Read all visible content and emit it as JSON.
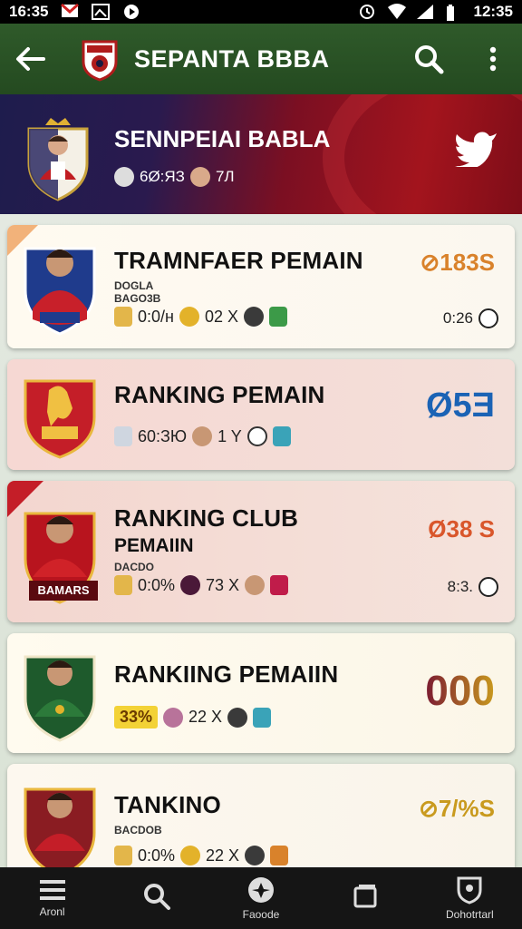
{
  "status_bar": {
    "time_left": "16:35",
    "time_right": "12:35"
  },
  "app_bar": {
    "title": "SEPANTA BBBA"
  },
  "hero": {
    "title": "SENNPEIAI BABLA",
    "meta_a": "6Ø:ЯЗ",
    "meta_b": "7Л"
  },
  "cards": [
    {
      "title": "TRAMNFAER PEMAIN",
      "tiny_a": "DOGLA",
      "tiny_b": "BAGO3B",
      "stat_1": "0:0/н",
      "stat_2": "02 X",
      "score": "⊘183S",
      "sub_score": "0:26"
    },
    {
      "title": "RANKING PEMAIN",
      "stat_1": "60:ЗЮ",
      "stat_2": "1 Y",
      "score": "Ø5Ǝ"
    },
    {
      "title": "RANKING CLUB",
      "sub": "PEMAIIN",
      "tiny_a": "DACDO",
      "crest_label": "BAMARS",
      "stat_1": "0:0%",
      "stat_2": "73 X",
      "score": "Ø38 S",
      "sub_score": "8:3."
    },
    {
      "title": "RANKIING PEMAIIN",
      "badge": "33%",
      "stat_2": "22 X",
      "score": "000"
    },
    {
      "title": "TANKINO",
      "tiny_a": "BACDOB",
      "stat_1": "0:0%",
      "stat_2": "22 X",
      "score": "⊘7/%S"
    }
  ],
  "bottom_nav": [
    {
      "label": "Aronl"
    },
    {
      "label": ""
    },
    {
      "label": "Faoode"
    },
    {
      "label": ""
    },
    {
      "label": "Dohotrtarl"
    }
  ],
  "colors": {
    "appbar": "#2f5a2a",
    "hero_red": "#a3141d",
    "hero_navy": "#1e1c4d",
    "score_orange": "#d9822b",
    "score_blue": "#1b63b5",
    "score_gold": "#c99a1e",
    "score_maroon": "#7a1a32"
  }
}
